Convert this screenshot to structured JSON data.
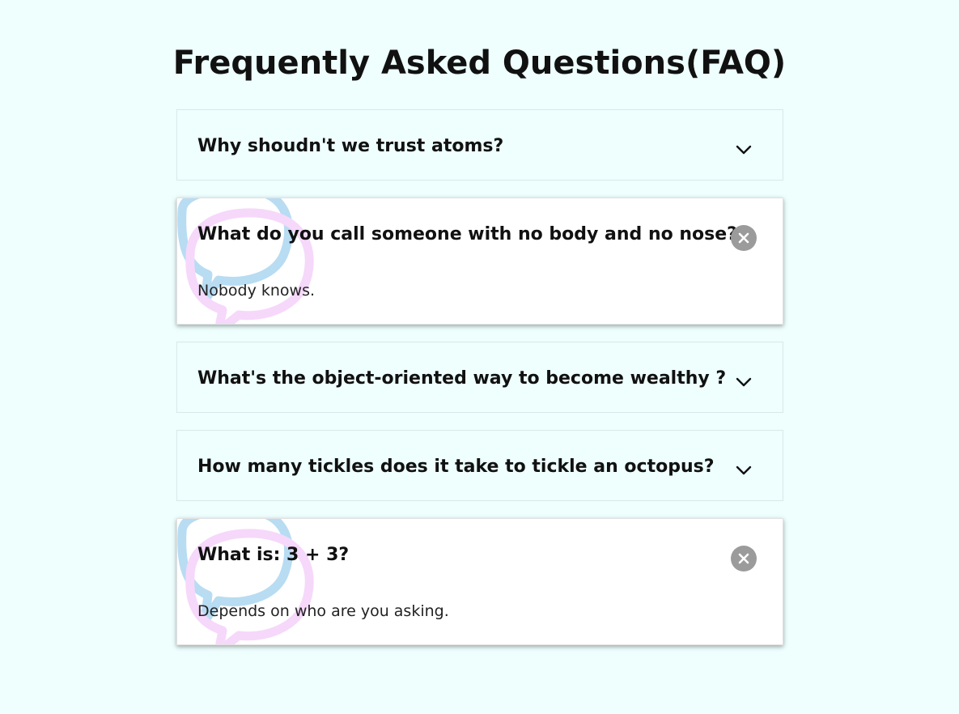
{
  "page": {
    "title": "Frequently Asked Questions(FAQ)"
  },
  "faqs": [
    {
      "question": "Why shoudn't we trust atoms?",
      "answer": "",
      "state": "closed",
      "icon": "chevron-down-icon"
    },
    {
      "question": "What do you call someone with no body and no nose?",
      "answer": "Nobody knows.",
      "state": "open",
      "icon": "close-icon"
    },
    {
      "question": "What's the object-oriented way to become wealthy ?",
      "answer": "",
      "state": "closed",
      "icon": "chevron-down-icon"
    },
    {
      "question": "How many tickles does it take to tickle an octopus?",
      "answer": "",
      "state": "closed",
      "icon": "chevron-down-icon"
    },
    {
      "question": "What is: 3 + 3?",
      "answer": "Depends on who are you asking.",
      "state": "open",
      "icon": "close-icon"
    }
  ],
  "colors": {
    "background": "#eefffe",
    "card_open": "#ffffff",
    "toggle_close": "#9b9b9b",
    "deco_blue": "#b8dcf2",
    "deco_pink": "#f6d8fb"
  }
}
